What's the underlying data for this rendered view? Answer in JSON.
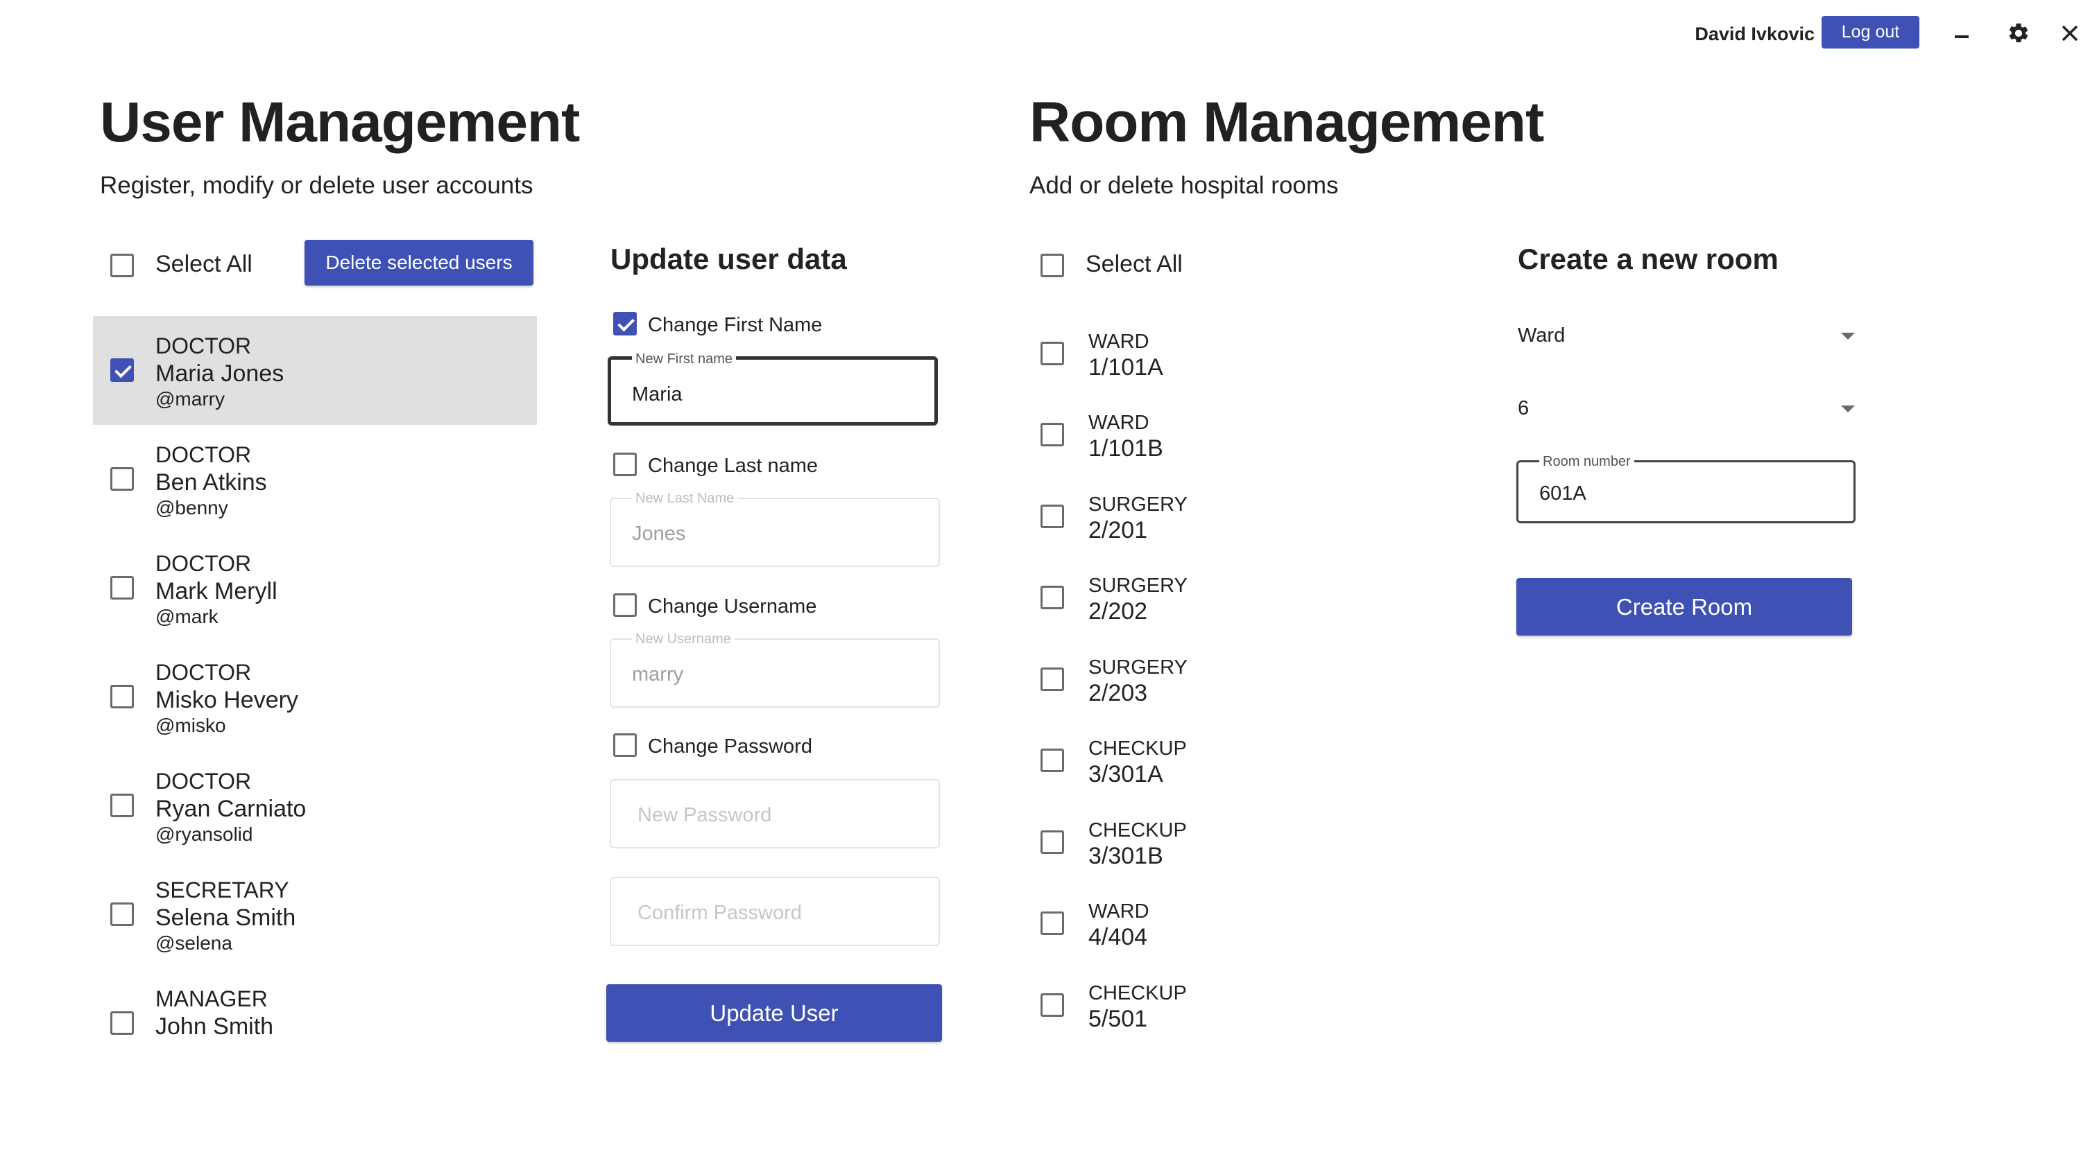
{
  "header": {
    "user_name": "David Ivkovic",
    "logout_label": "Log out",
    "icons": [
      "minimize-icon",
      "settings-icon",
      "close-icon"
    ]
  },
  "user_management": {
    "title": "User Management",
    "subtitle": "Register, modify or delete user accounts",
    "select_all_label": "Select All",
    "select_all_checked": false,
    "delete_button_label": "Delete selected users",
    "users": [
      {
        "role": "DOCTOR",
        "name": "Maria Jones",
        "username": "@marry",
        "checked": true
      },
      {
        "role": "DOCTOR",
        "name": "Ben Atkins",
        "username": "@benny",
        "checked": false
      },
      {
        "role": "DOCTOR",
        "name": "Mark Meryll",
        "username": "@mark",
        "checked": false
      },
      {
        "role": "DOCTOR",
        "name": "Misko Hevery",
        "username": "@misko",
        "checked": false
      },
      {
        "role": "DOCTOR",
        "name": "Ryan Carniato",
        "username": "@ryansolid",
        "checked": false
      },
      {
        "role": "SECRETARY",
        "name": "Selena Smith",
        "username": "@selena",
        "checked": false
      },
      {
        "role": "MANAGER",
        "name": "John Smith",
        "username": "",
        "checked": false
      }
    ]
  },
  "update_user": {
    "title": "Update user data",
    "change_first_name": {
      "label": "Change First Name",
      "checked": true
    },
    "first_name_field": {
      "label": "New First name",
      "value": "Maria"
    },
    "change_last_name": {
      "label": "Change Last name",
      "checked": false
    },
    "last_name_field": {
      "label": "New Last Name",
      "value": "Jones"
    },
    "change_username": {
      "label": "Change Username",
      "checked": false
    },
    "username_field": {
      "label": "New Username",
      "value": "marry"
    },
    "change_password": {
      "label": "Change Password",
      "checked": false
    },
    "new_password_placeholder": "New Password",
    "confirm_password_placeholder": "Confirm Password",
    "submit_label": "Update User"
  },
  "room_management": {
    "title": "Room Management",
    "subtitle": "Add or delete hospital rooms",
    "select_all_label": "Select All",
    "select_all_checked": false,
    "rooms": [
      {
        "type": "WARD",
        "number": "1/101A",
        "checked": false
      },
      {
        "type": "WARD",
        "number": "1/101B",
        "checked": false
      },
      {
        "type": "SURGERY",
        "number": "2/201",
        "checked": false
      },
      {
        "type": "SURGERY",
        "number": "2/202",
        "checked": false
      },
      {
        "type": "SURGERY",
        "number": "2/203",
        "checked": false
      },
      {
        "type": "CHECKUP",
        "number": "3/301A",
        "checked": false
      },
      {
        "type": "CHECKUP",
        "number": "3/301B",
        "checked": false
      },
      {
        "type": "WARD",
        "number": "4/404",
        "checked": false
      },
      {
        "type": "CHECKUP",
        "number": "5/501",
        "checked": false
      }
    ]
  },
  "create_room": {
    "title": "Create a new room",
    "room_type_value": "Ward",
    "floor_value": "6",
    "room_number_field": {
      "label": "Room number",
      "value": "601A"
    },
    "submit_label": "Create Room"
  },
  "colors": {
    "accent": "#3f51b5",
    "selected_row": "#e0e0e0",
    "text": "#212121"
  }
}
